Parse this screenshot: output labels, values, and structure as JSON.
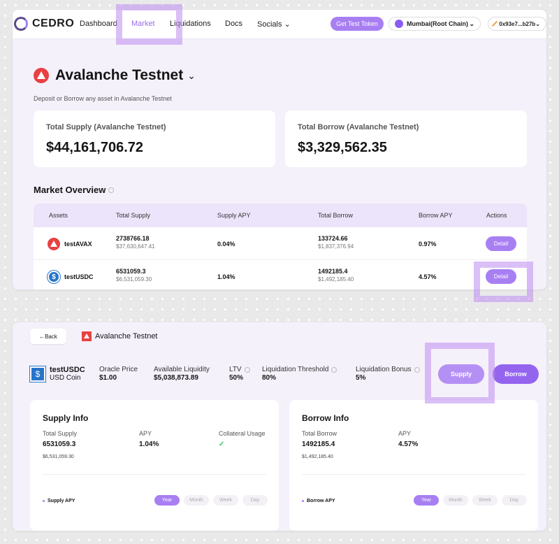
{
  "nav": {
    "logo": "CEDRO",
    "links": [
      "Dashboard",
      "Market",
      "Liquidations",
      "Docs",
      "Socials"
    ],
    "test_token": "Get Test Token",
    "chain": "Mumbai(Root Chain)",
    "wallet": "0x93e7...b27b"
  },
  "network": {
    "title": "Avalanche Testnet",
    "subtitle": "Deposit or Borrow any asset in Avalanche Testnet",
    "total_supply_label": "Total Supply (Avalanche Testnet)",
    "total_supply_value": "$44,161,706.72",
    "total_borrow_label": "Total Borrow (Avalanche Testnet)",
    "total_borrow_value": "$3,329,562.35"
  },
  "market": {
    "title": "Market Overview",
    "columns": [
      "Assets",
      "Total Supply",
      "Supply APY",
      "Total Borrow",
      "Borrow APY",
      "Actions"
    ],
    "rows": [
      {
        "asset": "testAVAX",
        "supply": "2738766.18",
        "supply_usd": "$37,630,647.41",
        "supply_apy": "0.04%",
        "borrow": "133724.66",
        "borrow_usd": "$1,837,376.94",
        "borrow_apy": "0.97%",
        "action": "Detail"
      },
      {
        "asset": "testUSDC",
        "supply": "6531059.3",
        "supply_usd": "$6,531,059.30",
        "supply_apy": "1.04%",
        "borrow": "1492185.4",
        "borrow_usd": "$1,492,185.40",
        "borrow_apy": "4.57%",
        "action": "Detail"
      }
    ]
  },
  "detail": {
    "back": "←Back",
    "network": "Avalanche Testnet",
    "token_symbol": "testUSDC",
    "token_name": "USD Coin",
    "oracle_price_label": "Oracle Price",
    "oracle_price": "$1.00",
    "liquidity_label": "Available Liquidity",
    "liquidity": "$5,038,873.89",
    "ltv_label": "LTV",
    "ltv": "50%",
    "liq_threshold_label": "Liquidation Threshold",
    "liq_threshold": "80%",
    "liq_bonus_label": "Liquidation Bonus",
    "liq_bonus": "5%",
    "supply_btn": "Supply",
    "borrow_btn": "Borrow",
    "supply_info": {
      "title": "Supply Info",
      "total_label": "Total Supply",
      "total": "6531059.3",
      "total_usd": "$6,531,059.30",
      "apy_label": "APY",
      "apy": "1.04%",
      "collateral_label": "Collateral Usage",
      "chart_label": "Supply APY"
    },
    "borrow_info": {
      "title": "Borrow Info",
      "total_label": "Total Borrow",
      "total": "1492185.4",
      "total_usd": "$1,492,185.40",
      "apy_label": "APY",
      "apy": "4.57%",
      "chart_label": "Borrow APY"
    },
    "ranges": [
      "Year",
      "Month",
      "Week",
      "Day"
    ]
  }
}
